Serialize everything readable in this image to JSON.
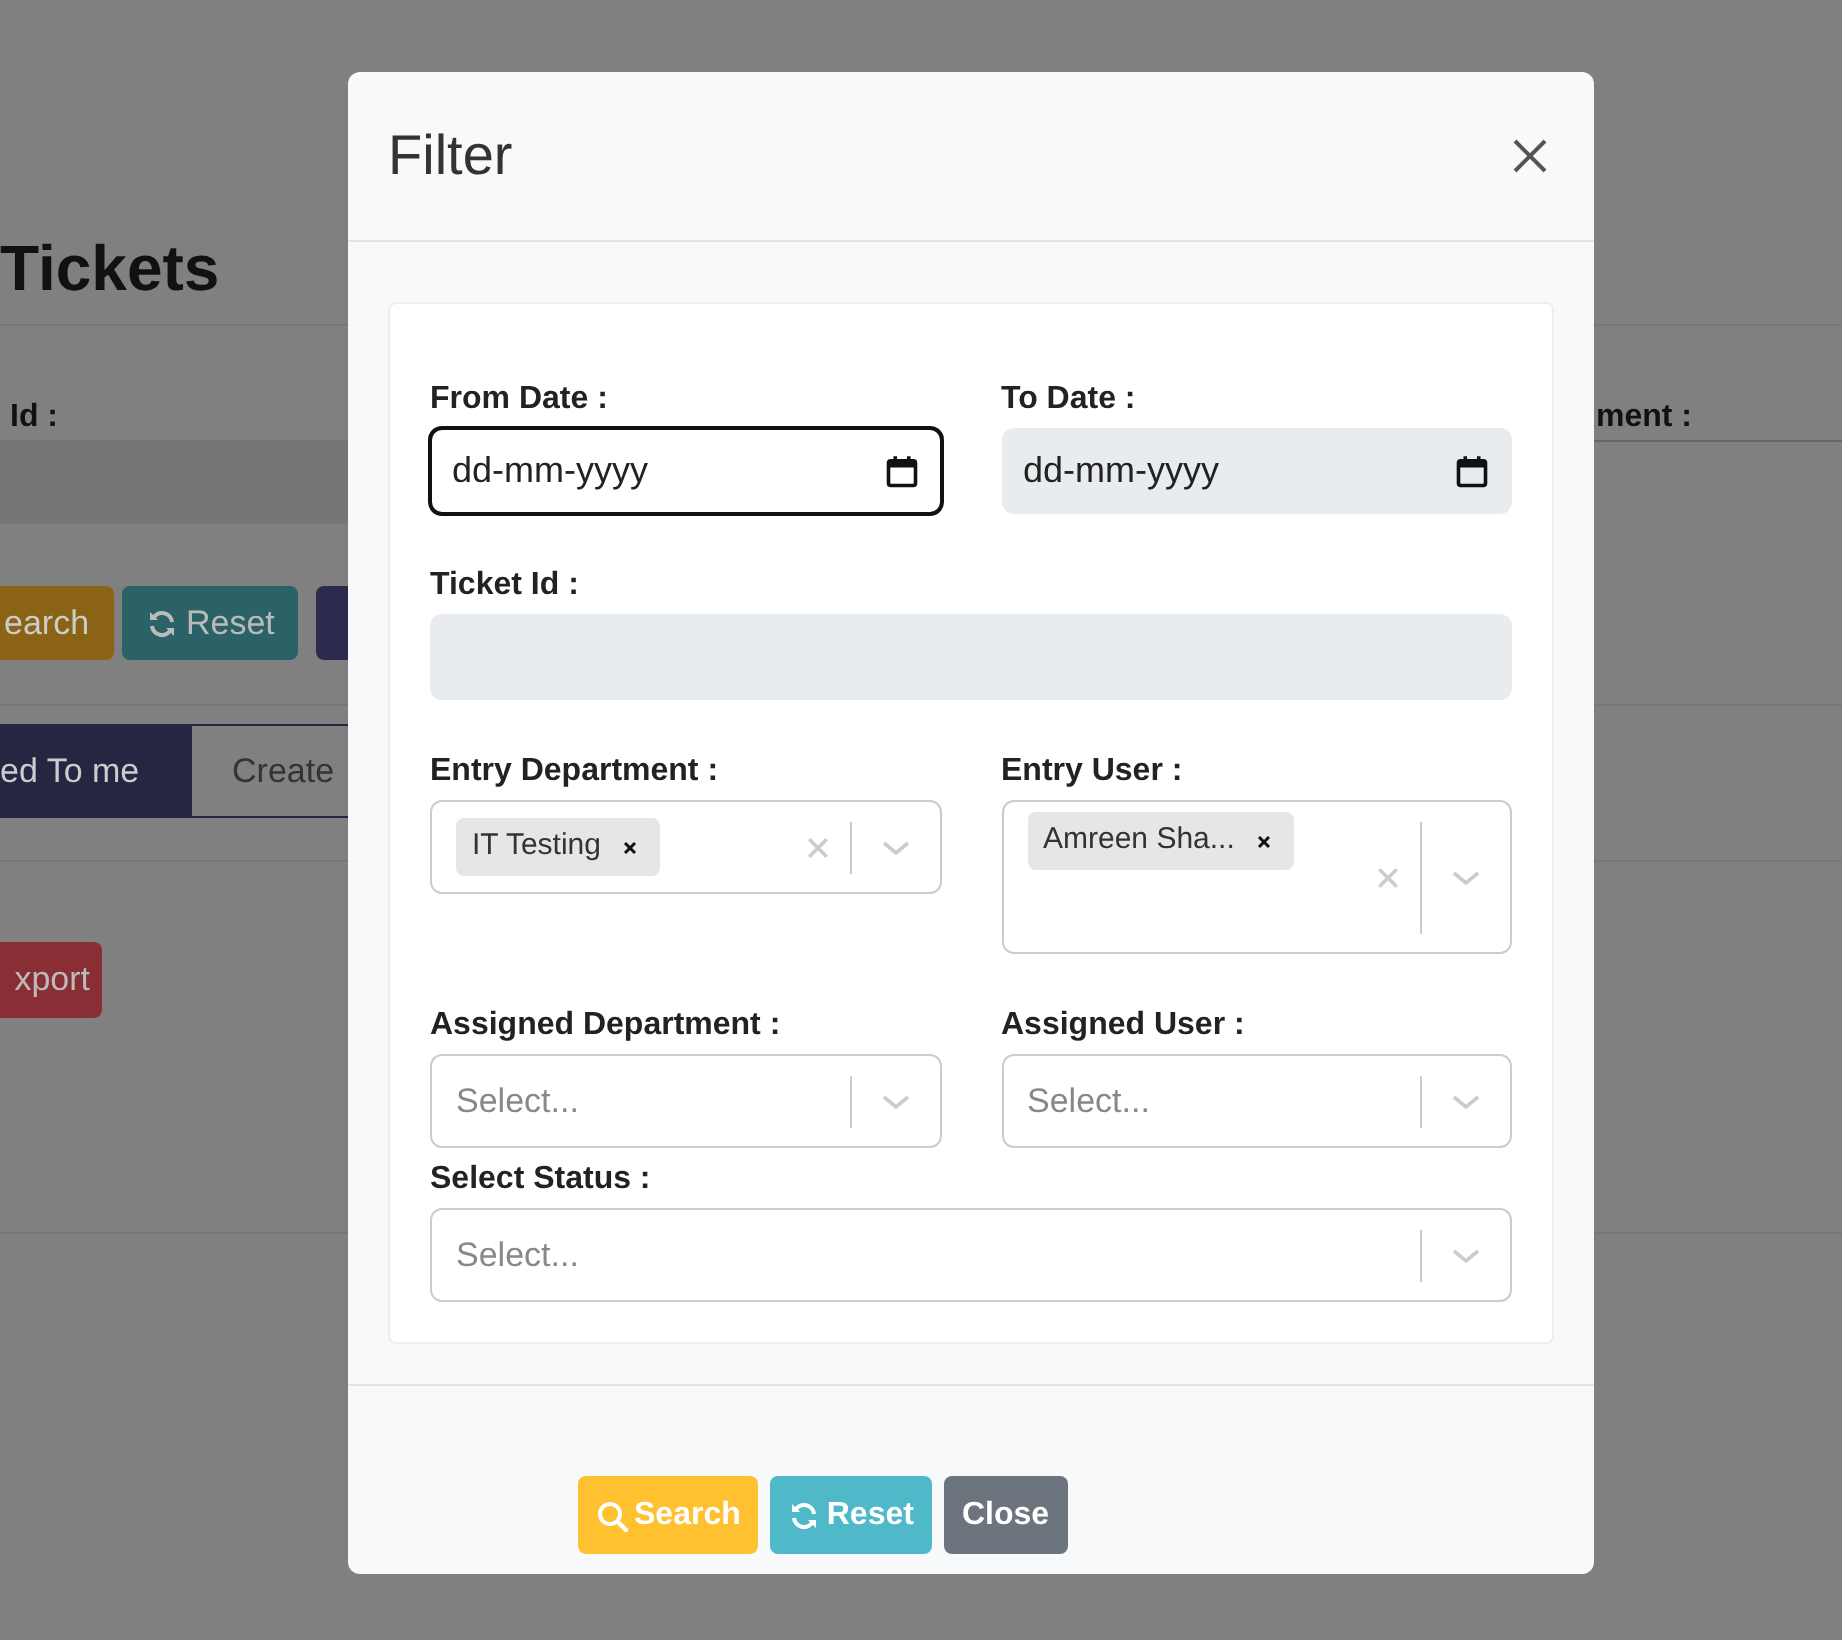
{
  "background_page": {
    "title": "Tickets",
    "field_label": "Id :",
    "right_label": "ment :",
    "buttons": [
      {
        "label": "earch",
        "kind": "search"
      },
      {
        "label": "Reset",
        "kind": "reset"
      },
      {
        "kind": "primary"
      }
    ],
    "tabs": [
      {
        "label": "ed To me",
        "selected": true
      },
      {
        "label": "Create",
        "selected": false
      }
    ],
    "export_button": "xport"
  },
  "dialog": {
    "title": "Filter",
    "rows": [
      [
        {
          "label": "From Date :",
          "kind": "date",
          "value": "dd-mm-yyyy",
          "focused": true,
          "disabled": false
        },
        {
          "label": "To Date :",
          "kind": "date",
          "value": "dd-mm-yyyy",
          "focused": false,
          "disabled": true
        }
      ],
      [
        {
          "label": "Ticket Id :",
          "kind": "text",
          "disabled": true
        }
      ],
      [
        {
          "label": "Entry Department :",
          "kind": "multiselect",
          "tags": [
            "IT Testing"
          ]
        },
        {
          "label": "Entry User :",
          "kind": "multiselect",
          "tags": [
            "Amreen Sha..."
          ]
        }
      ],
      [
        {
          "label": "Assigned Department :",
          "kind": "select",
          "placeholder": "Select..."
        },
        {
          "label": "Assigned User :",
          "kind": "select",
          "placeholder": "Select..."
        }
      ],
      [
        {
          "label": "Select Status :",
          "kind": "select",
          "placeholder": "Select..."
        }
      ]
    ],
    "buttons": [
      {
        "label": "Search",
        "kind": "search"
      },
      {
        "label": "Reset",
        "kind": "reset"
      },
      {
        "label": "Close",
        "kind": "close"
      }
    ]
  }
}
